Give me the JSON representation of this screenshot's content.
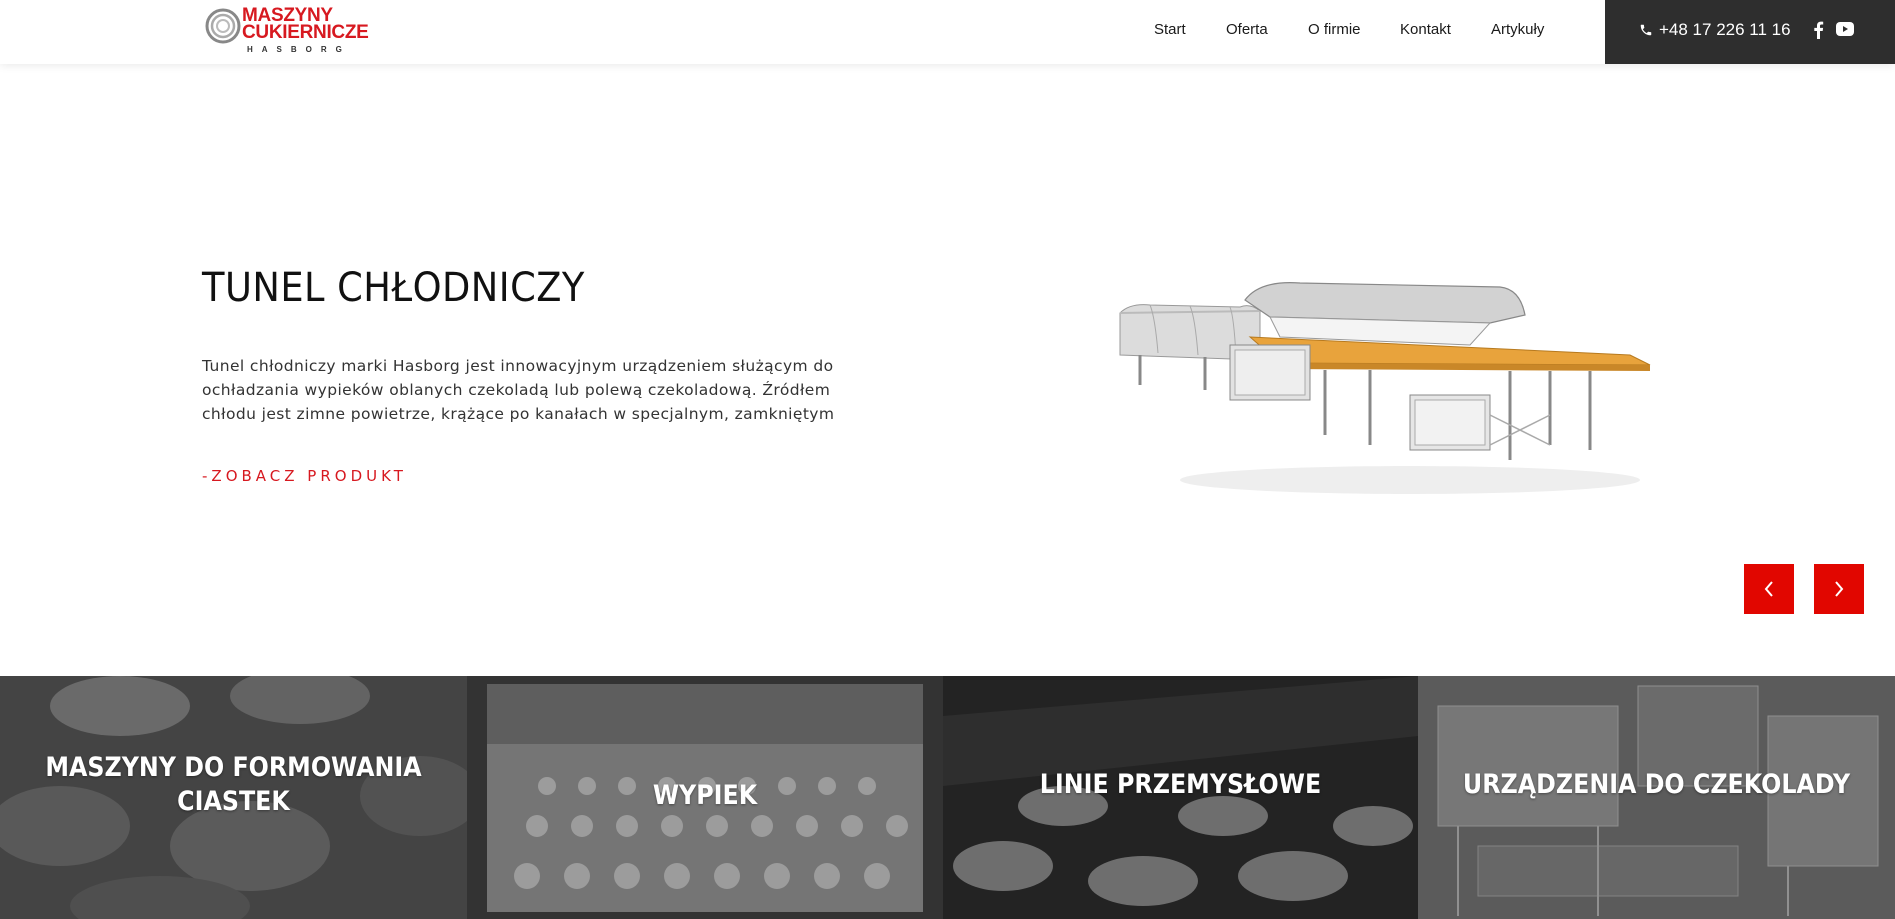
{
  "header": {
    "logo": {
      "line1": "MASZYNY",
      "line2": "CUKIERNICZE",
      "line3": "HASBORG"
    },
    "nav": [
      {
        "label": "Start"
      },
      {
        "label": "Oferta"
      },
      {
        "label": "O firmie"
      },
      {
        "label": "Kontakt"
      },
      {
        "label": "Artykuły"
      }
    ],
    "phone": "+48 17 226 11 16",
    "social": [
      "facebook-icon",
      "youtube-icon"
    ]
  },
  "hero": {
    "title": "TUNEL CHŁODNICZY",
    "description": "Tunel chłodniczy marki Hasborg jest innowacyjnym urządzeniem służącym do ochładzania wypieków oblanych czekoladą lub polewą czekoladową. Źródłem chłodu jest zimne powietrze, krążące po kanałach w specjalnym, zamkniętym",
    "cta": "-ZOBACZ PRODUKT"
  },
  "slider": {
    "prev_icon": "chevron-left-icon",
    "next_icon": "chevron-right-icon"
  },
  "categories": [
    {
      "title": "MASZYNY DO FORMOWANIA CIASTEK"
    },
    {
      "title": "WYPIEK"
    },
    {
      "title": "LINIE PRZEMYSŁOWE"
    },
    {
      "title": "URZĄDZENIA DO CZEKOLADY"
    }
  ],
  "colors": {
    "accent": "#d71920",
    "arrow_bg": "#e10600",
    "contact_bg": "#2e2e2e",
    "text": "#111111"
  }
}
